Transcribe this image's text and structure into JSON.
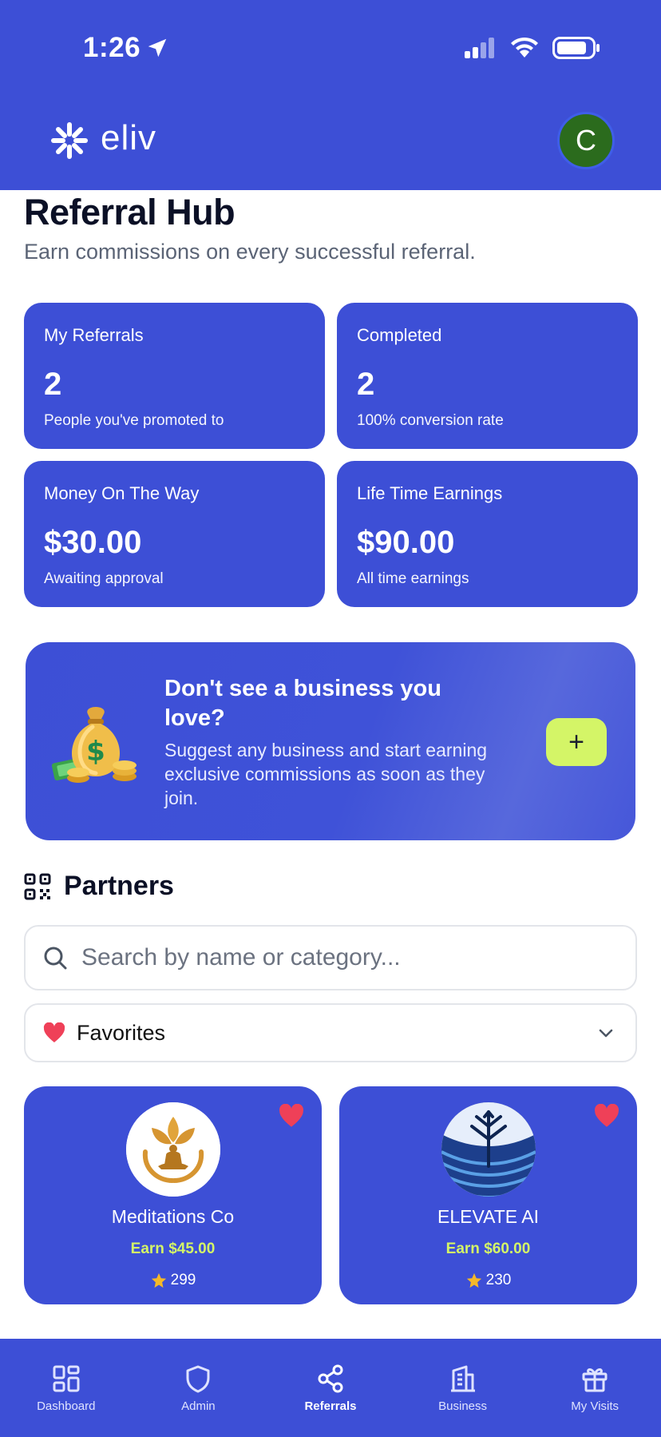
{
  "status_bar": {
    "time": "1:26"
  },
  "header": {
    "logo_text": "eliv",
    "avatar_initial": "C"
  },
  "page": {
    "title": "Referral Hub",
    "subtitle": "Earn commissions on every successful referral."
  },
  "stats": [
    {
      "label": "My Referrals",
      "value": "2",
      "sub": "People you've promoted to"
    },
    {
      "label": "Completed",
      "value": "2",
      "sub": "100% conversion rate"
    },
    {
      "label": "Money On The Way",
      "value": "$30.00",
      "sub": "Awaiting approval"
    },
    {
      "label": "Life Time Earnings",
      "value": "$90.00",
      "sub": "All time earnings"
    }
  ],
  "promo": {
    "title": "Don't see a business you love?",
    "body": "Suggest any business and start earning exclusive commissions as soon as they join.",
    "button_label": "+"
  },
  "partners": {
    "heading": "Partners",
    "search_placeholder": "Search by name or category...",
    "filter_selected": "Favorites",
    "items": [
      {
        "name": "Meditations Co",
        "earn": "Earn $45.00",
        "rating": "299"
      },
      {
        "name": "ELEVATE AI",
        "earn": "Earn $60.00",
        "rating": "230"
      }
    ]
  },
  "colors": {
    "brand": "#3d4fd6",
    "accent": "#d4f567",
    "heart": "#ef4058",
    "star": "#f5b829"
  },
  "tabs": [
    {
      "label": "Dashboard",
      "icon": "dashboard-icon"
    },
    {
      "label": "Admin",
      "icon": "shield-icon"
    },
    {
      "label": "Referrals",
      "icon": "share-icon",
      "active": true
    },
    {
      "label": "Business",
      "icon": "building-icon"
    },
    {
      "label": "My Visits",
      "icon": "gift-icon"
    }
  ]
}
